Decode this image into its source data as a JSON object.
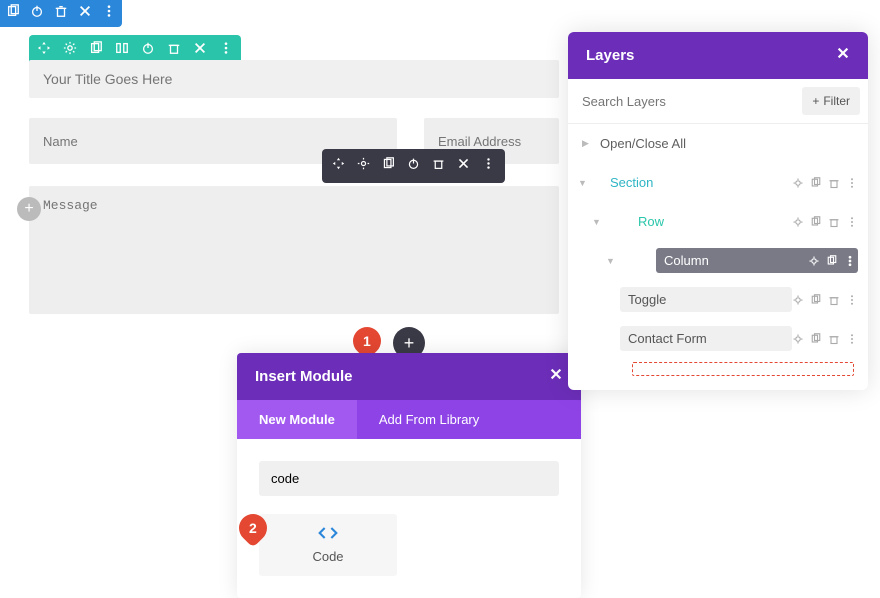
{
  "top_toolbar": {
    "icons": [
      "copy",
      "power",
      "trash",
      "close",
      "more"
    ]
  },
  "green_toolbar": {
    "icons": [
      "move",
      "gear",
      "copy",
      "columns",
      "power",
      "trash",
      "close",
      "more"
    ]
  },
  "dark_toolbar": {
    "icons": [
      "move",
      "gear",
      "copy",
      "power",
      "trash",
      "close",
      "more"
    ]
  },
  "form": {
    "title_placeholder": "Your Title Goes Here",
    "name_placeholder": "Name",
    "email_placeholder": "Email Address",
    "message_placeholder": "Message"
  },
  "badges": {
    "one": "1",
    "two": "2"
  },
  "modal": {
    "title": "Insert Module",
    "tabs": {
      "new": "New Module",
      "library": "Add From Library"
    },
    "search_value": "code",
    "option": {
      "label": "Code"
    }
  },
  "layers": {
    "title": "Layers",
    "search_placeholder": "Search Layers",
    "filter_label": "Filter",
    "open_close": "Open/Close All",
    "items": {
      "section": "Section",
      "row": "Row",
      "column": "Column",
      "toggle": "Toggle",
      "contact": "Contact Form"
    }
  },
  "colors": {
    "purple": "#6c2eb9",
    "purple_light": "#8e43e7",
    "teal": "#29c4a9",
    "red": "#e44732"
  }
}
